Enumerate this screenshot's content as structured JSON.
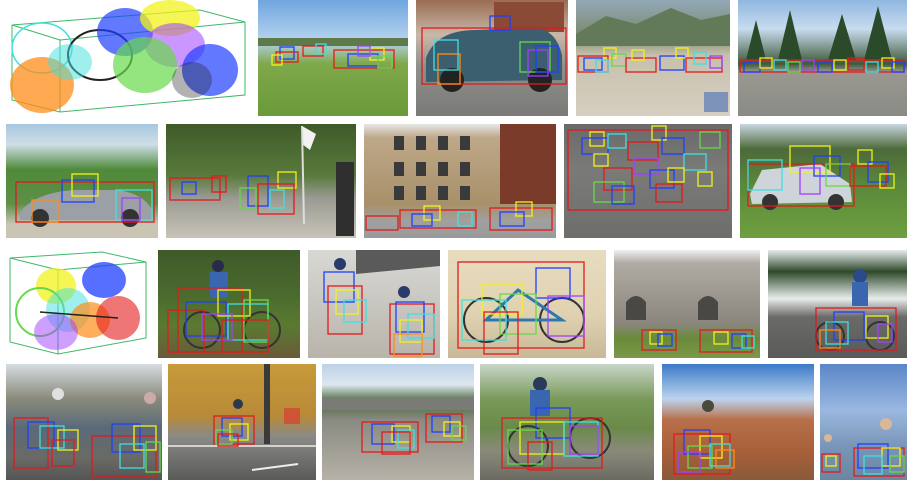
{
  "rows": [
    {
      "category": "car",
      "tiles": [
        "car-3d-model",
        "car-photo-1",
        "car-photo-2",
        "car-photo-3",
        "car-photo-4"
      ]
    },
    {
      "category": "car",
      "tiles": [
        "car-photo-5",
        "car-photo-6",
        "car-photo-7",
        "car-photo-8",
        "car-photo-9"
      ]
    },
    {
      "category": "bicycle",
      "tiles": [
        "bicycle-3d-model",
        "bicycle-photo-1",
        "bicycle-photo-2",
        "bicycle-photo-3",
        "bicycle-photo-4",
        "bicycle-photo-5"
      ]
    },
    {
      "category": "bicycle",
      "tiles": [
        "bicycle-photo-6",
        "bicycle-photo-7",
        "bicycle-photo-8",
        "bicycle-photo-9",
        "bicycle-photo-10",
        "bicycle-photo-11"
      ]
    }
  ],
  "colors": {
    "background": "#ffffff",
    "sky": "#9cc3e8",
    "grass": "#6a9a3a",
    "road": "#8a8a86",
    "box_red": "#e31a1c",
    "box_blue": "#1f3fff",
    "box_yellow": "#f2f21a",
    "box_cyan": "#3fe0e0",
    "box_green": "#66d94a",
    "box_orange": "#ff8c1a",
    "box_purple": "#a040ff"
  }
}
